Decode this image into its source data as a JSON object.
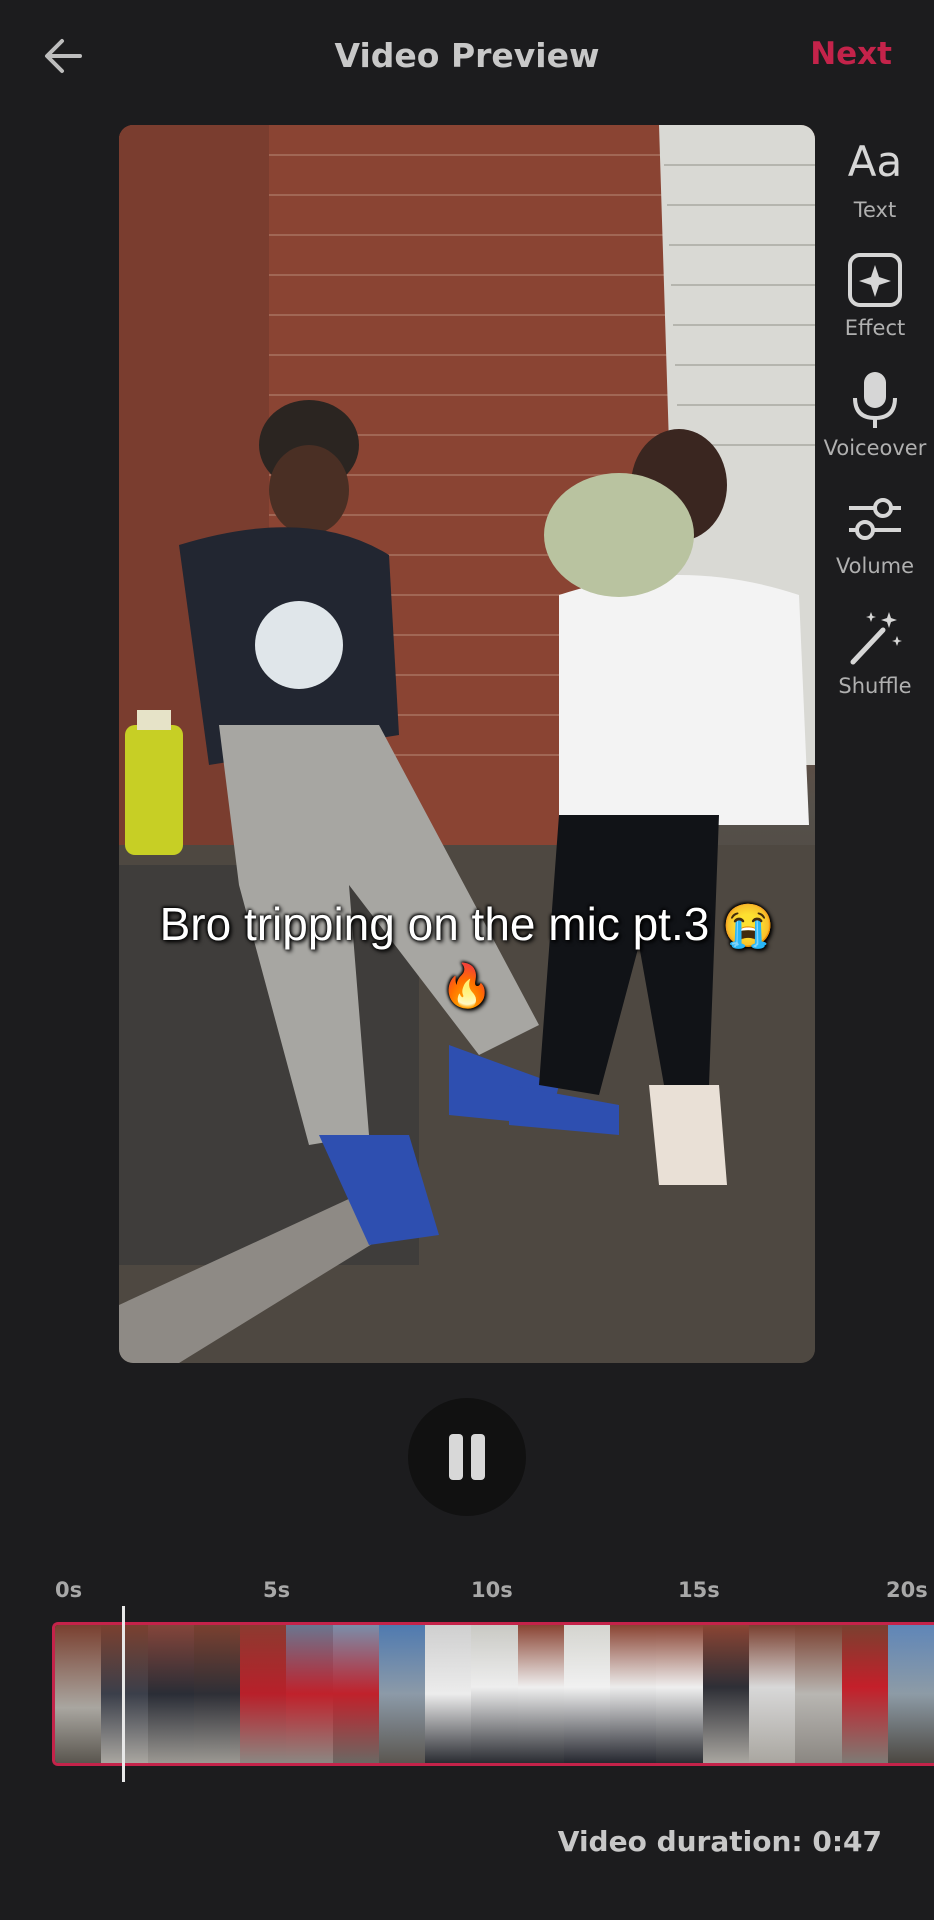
{
  "header": {
    "back_icon": "arrow-left-icon",
    "title": "Video Preview",
    "next_label": "Next",
    "accent_color": "#c4234a"
  },
  "video": {
    "caption_text": "Bro tripping on the mic pt.3",
    "caption_emoji_1": "😭",
    "caption_emoji_2": "🔥"
  },
  "tools": [
    {
      "label": "Text",
      "icon": "text-aa-icon"
    },
    {
      "label": "Effect",
      "icon": "effect-sparkle-icon"
    },
    {
      "label": "Voiceover",
      "icon": "microphone-icon"
    },
    {
      "label": "Volume",
      "icon": "sliders-icon"
    },
    {
      "label": "Shuffle",
      "icon": "magic-wand-icon"
    }
  ],
  "playback": {
    "state_icon": "pause-icon"
  },
  "timeline": {
    "ticks": [
      "0s",
      "5s",
      "10s",
      "15s",
      "20s"
    ]
  },
  "footer": {
    "duration_text": "Video duration: 0:47"
  }
}
